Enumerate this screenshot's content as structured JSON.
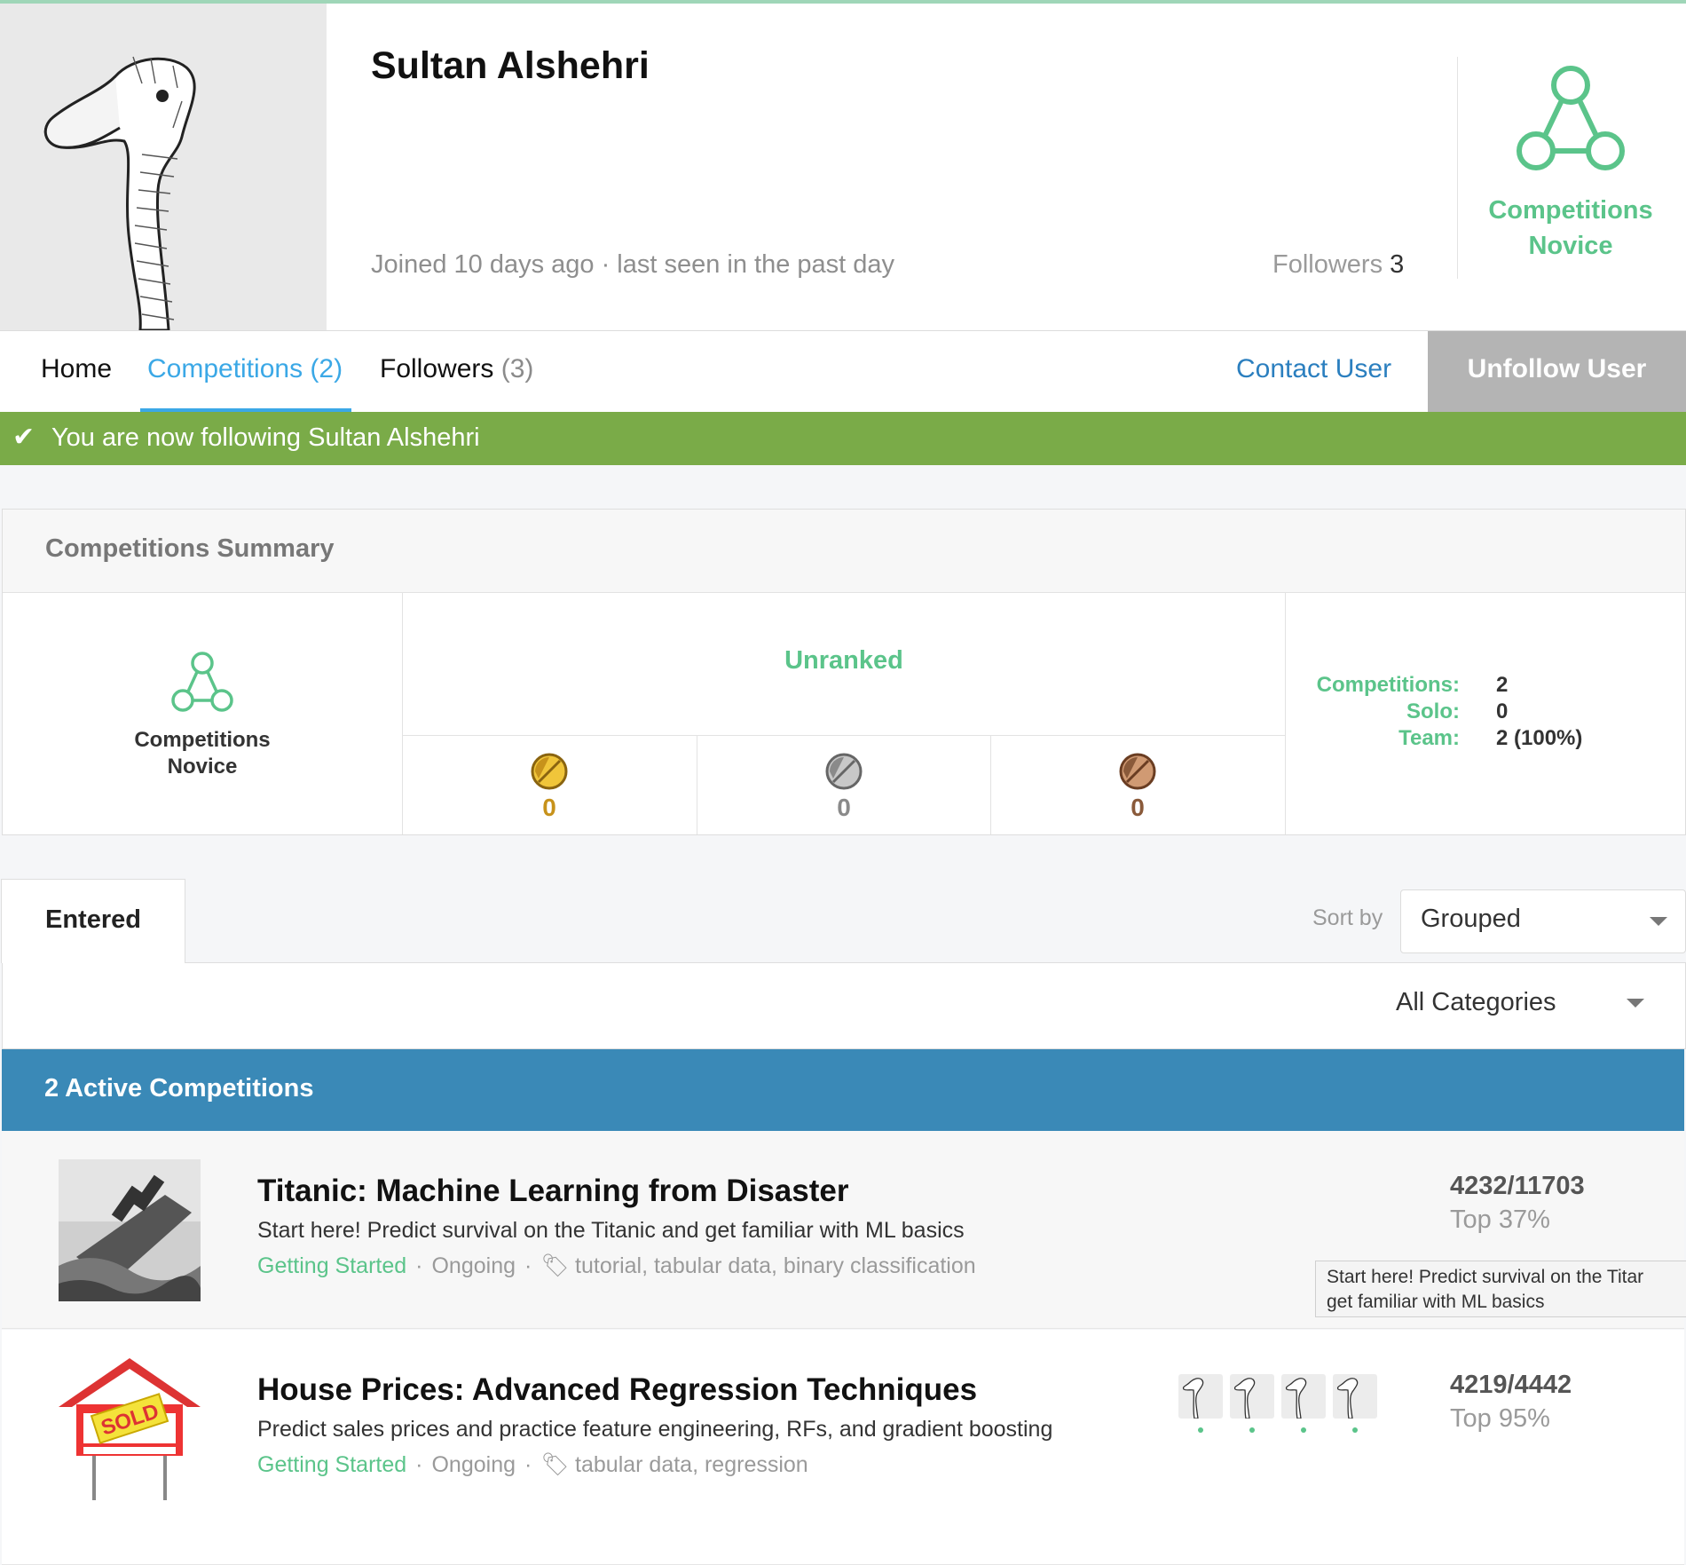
{
  "profile": {
    "name": "Sultan Alshehri",
    "joined": "Joined 10 days ago · last seen in the past day",
    "followers_label": "Followers",
    "followers_count": "3",
    "tier_line1": "Competitions",
    "tier_line2": "Novice"
  },
  "nav": {
    "home": "Home",
    "competitions": "Competitions",
    "competitions_count": "(2)",
    "followers": "Followers",
    "followers_count": "(3)",
    "contact": "Contact User",
    "unfollow": "Unfollow User"
  },
  "banner": {
    "message": "You are now following Sultan Alshehri"
  },
  "summary": {
    "title": "Competitions Summary",
    "tier_line1": "Competitions",
    "tier_line2": "Novice",
    "rank": "Unranked",
    "medals": [
      {
        "type": "gold",
        "count": "0",
        "color": "#c7921b"
      },
      {
        "type": "silver",
        "count": "0",
        "color": "#8a8a8a"
      },
      {
        "type": "bronze",
        "count": "0",
        "color": "#8a5a3a"
      }
    ],
    "stats": [
      {
        "label": "Competitions:",
        "value": "2"
      },
      {
        "label": "Solo:",
        "value": "0"
      },
      {
        "label": "Team:",
        "value": "2 (100%)"
      }
    ]
  },
  "tabs": {
    "entered": "Entered",
    "sort_label": "Sort by",
    "sort_value": "Grouped",
    "category_value": "All Categories"
  },
  "active_header": "2 Active Competitions",
  "competitions": [
    {
      "title": "Titanic: Machine Learning from Disaster",
      "description": "Start here! Predict survival on the Titanic and get familiar with ML basics",
      "category": "Getting Started",
      "status": "Ongoing",
      "tags": "tutorial, tabular data, binary classification",
      "rank": "4232/11703",
      "top": "Top 37%"
    },
    {
      "title": "House Prices: Advanced Regression Techniques",
      "description": "Predict sales prices and practice feature engineering, RFs, and gradient boosting",
      "category": "Getting Started",
      "status": "Ongoing",
      "tags": "tabular data, regression",
      "rank": "4219/4442",
      "top": "Top 95%",
      "sign_text": "SOLD"
    }
  ],
  "tooltip": {
    "line1": "Start here! Predict survival on the Titar",
    "line2": "get familiar with ML basics"
  },
  "colors": {
    "accent_green": "#5bc48a",
    "link_blue": "#3ba8e6",
    "banner_green": "#7aab48",
    "header_blue": "#3a89b7"
  }
}
